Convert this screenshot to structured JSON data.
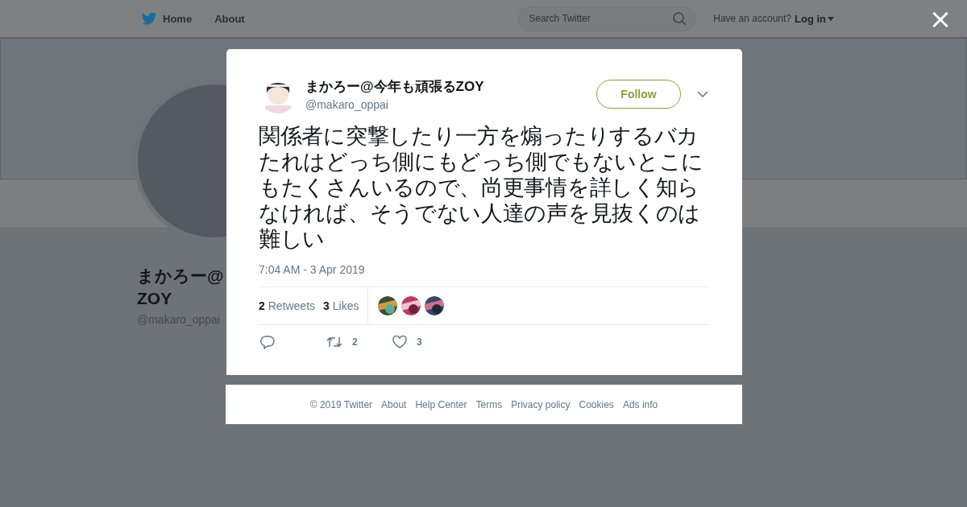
{
  "top_bar": {
    "nav": [
      {
        "label": "Home",
        "kind": "home"
      },
      {
        "label": "About",
        "kind": "plain"
      }
    ],
    "search": {
      "placeholder": "Search Twitter"
    },
    "account_prompt": "Have an account?",
    "login": "Log in"
  },
  "profile": {
    "name_line_1": "まかろー@",
    "name_line_2": "ZOY",
    "handle": "@makaro_oppai"
  },
  "close": "×",
  "tweet": {
    "display_name": "まかろー@今年も頑張るZOY",
    "handle": "@makaro_oppai",
    "follow": "Follow",
    "text": "関係者に突撃したり一方を煽ったりするバカたれはどっち側にもどっち側でもないとこにもたくさんいるので、尚更事情を詳しく知らなければ、そうでない人達の声を見抜くのは難しい",
    "timestamp": "7:04 AM - 3 Apr 2019",
    "stats": [
      {
        "count": "2",
        "label": "Retweets"
      },
      {
        "count": "3",
        "label": "Likes"
      }
    ],
    "actions": [
      {
        "kind": "reply"
      },
      {
        "kind": "retweet",
        "count": "2"
      },
      {
        "kind": "like",
        "count": "3"
      }
    ]
  },
  "footer": [
    "© 2019 Twitter",
    "About",
    "Help Center",
    "Terms",
    "Privacy policy",
    "Cookies",
    "Ads info"
  ]
}
